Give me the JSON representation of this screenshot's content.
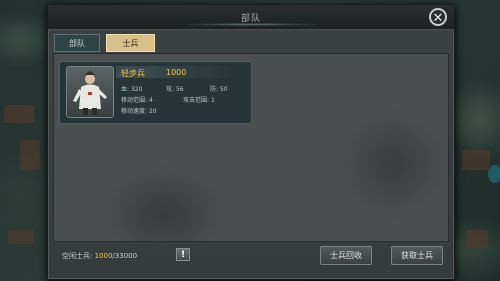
{
  "dialog": {
    "title": "部队",
    "close_icon": "close-icon"
  },
  "tabs": [
    {
      "label": "部队",
      "active": false
    },
    {
      "label": "士兵",
      "active": true
    }
  ],
  "soldier": {
    "name": "轻步兵",
    "power": "1000",
    "stats": {
      "hp_label": "血:",
      "hp": "320",
      "atk_label": "攻:",
      "atk": "56",
      "def_label": "防:",
      "def": "50",
      "move_range_label": "移动范围:",
      "move_range": "4",
      "attack_range_label": "攻击范围:",
      "attack_range": "1",
      "move_speed_label": "移动速度:",
      "move_speed": "20"
    }
  },
  "footer": {
    "idle_label": "空闲士兵:",
    "idle_current": "1000",
    "idle_total": "/33000",
    "info_icon": "!",
    "recycle_button": "士兵回收",
    "get_button": "获取士兵"
  },
  "colors": {
    "accent_gold": "#f2c440",
    "tab_active": "#d8c08a"
  }
}
